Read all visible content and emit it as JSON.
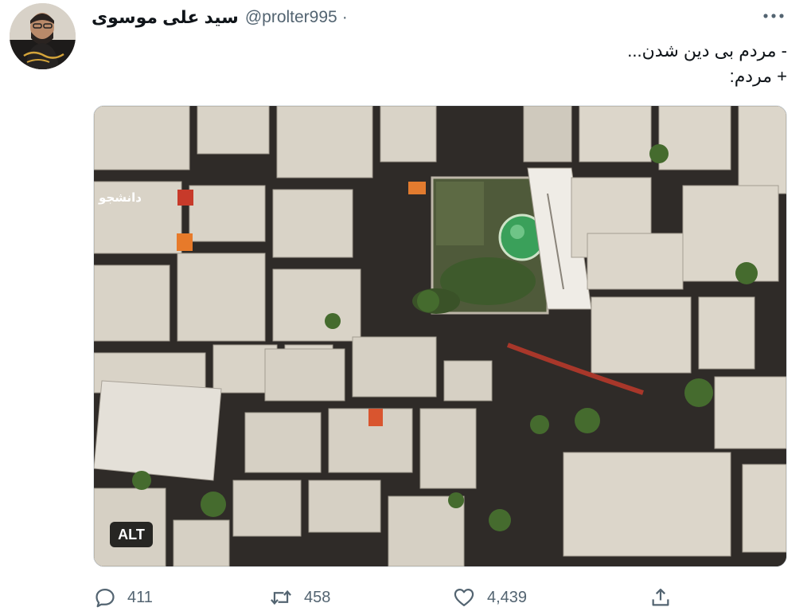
{
  "tweet": {
    "display_name": "سید علی موسوی",
    "handle": "@prolter995",
    "separator": "·",
    "lines": [
      "- مردم بی دین شدن...",
      "+ مردم:"
    ]
  },
  "media": {
    "alt_label": "ALT",
    "watermark": "دانشجو"
  },
  "actions": {
    "replies": "411",
    "retweets": "458",
    "likes": "4,439"
  },
  "icons": {
    "more": "more-dots-icon",
    "reply": "speech-bubble-icon",
    "retweet": "retweet-arrows-icon",
    "like": "heart-icon",
    "share": "share-upload-icon"
  },
  "colors": {
    "text_primary": "#0f1419",
    "text_secondary": "#536471",
    "dome": "#3aa05a"
  }
}
